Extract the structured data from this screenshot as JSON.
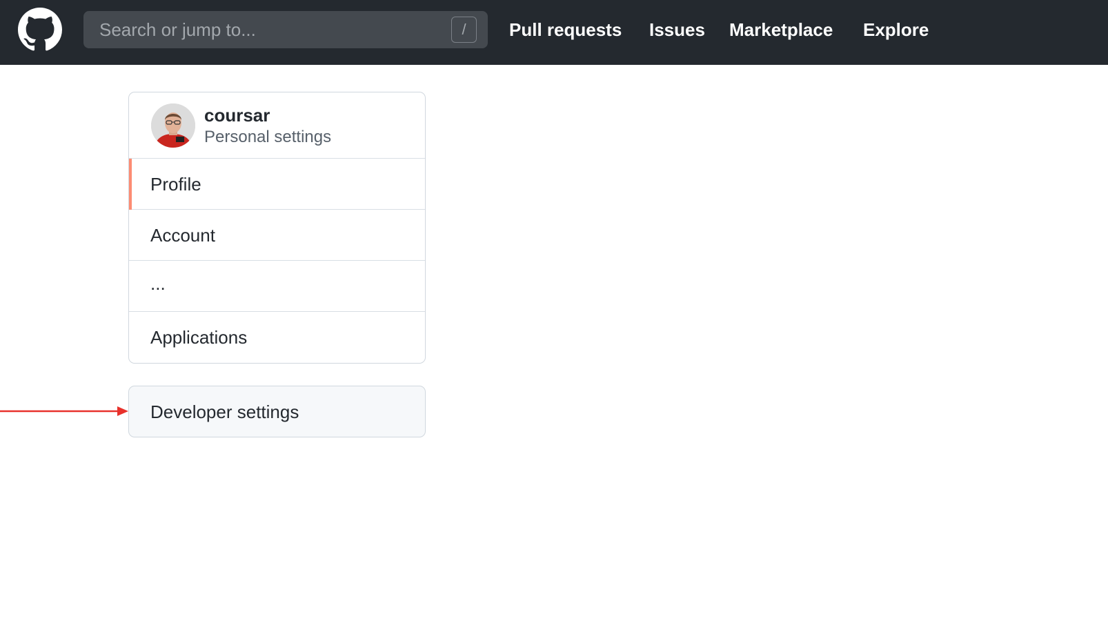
{
  "header": {
    "logo_icon": "github-octocat-icon",
    "search": {
      "placeholder": "Search or jump to...",
      "shortcut": "/"
    },
    "nav": [
      {
        "label": "Pull requests"
      },
      {
        "label": "Issues"
      },
      {
        "label": "Marketplace"
      },
      {
        "label": "Explore"
      }
    ]
  },
  "settings_menu": {
    "user": {
      "name": "coursar",
      "subtitle": "Personal settings"
    },
    "items": [
      {
        "label": "Profile",
        "active": true
      },
      {
        "label": "Account"
      },
      {
        "label": "..."
      },
      {
        "label": "Applications"
      }
    ],
    "developer": {
      "label": "Developer settings"
    }
  },
  "colors": {
    "header_bg": "#24292f",
    "active_marker": "#fd8c73",
    "annotation_arrow": "#e8312b"
  }
}
